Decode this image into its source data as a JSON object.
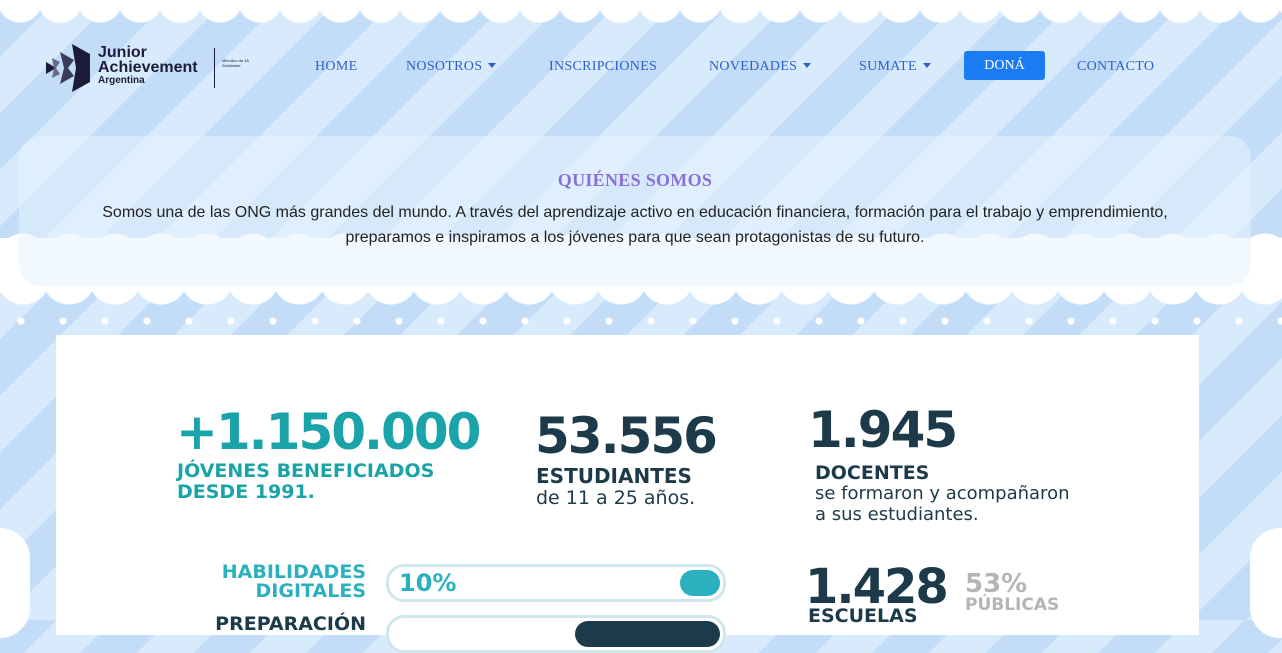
{
  "header": {
    "logo": {
      "line1": "Junior",
      "line2": "Achievement",
      "line3": "Argentina",
      "tagline": "Miembro de JA Worldwide"
    },
    "nav": [
      {
        "label": "HOME",
        "dropdown": false
      },
      {
        "label": "NOSOTROS",
        "dropdown": true
      },
      {
        "label": "INSCRIPCIONES",
        "dropdown": false
      },
      {
        "label": "NOVEDADES",
        "dropdown": true
      },
      {
        "label": "SUMATE",
        "dropdown": true
      },
      {
        "label": "DONÁ",
        "dropdown": false
      },
      {
        "label": "CONTACTO",
        "dropdown": false
      }
    ]
  },
  "about": {
    "title": "QUIÉNES SOMOS",
    "text": "Somos una de las ONG más grandes del mundo.  A través del aprendizaje activo en educación financiera, formación para el trabajo y emprendimiento, preparamos e inspiramos a los jóvenes para que sean protagonistas de su futuro."
  },
  "stats": {
    "youth": {
      "number": "+1.150.000",
      "label1": "JÓVENES BENEFICIADOS",
      "label2": "DESDE 1991."
    },
    "students": {
      "number": "53.556",
      "label": "ESTUDIANTES",
      "sub": "de 11 a 25 años."
    },
    "teachers": {
      "number": "1.945",
      "label": "DOCENTES",
      "sub1": "se formaron y acompañaron",
      "sub2": "a sus estudiantes."
    },
    "skills": [
      {
        "label1": "HABILIDADES",
        "label2": "DIGITALES",
        "value": "10%",
        "fraction": 0.1
      },
      {
        "label1": "PREPARACIÓN",
        "label2": "",
        "value": "",
        "fraction": 0.45
      }
    ],
    "schools": {
      "number": "1.428",
      "label": "ESCUELAS",
      "pct": "53%",
      "pct_label": "PÚBLICAS"
    }
  },
  "colors": {
    "nav": "#2e5fc9",
    "dona_bg": "#1a7bf2",
    "title": "#8a6fd9",
    "teal": "#1aa3a8",
    "navy": "#1d3a4a",
    "skill_bar": "#2bb0c0"
  }
}
